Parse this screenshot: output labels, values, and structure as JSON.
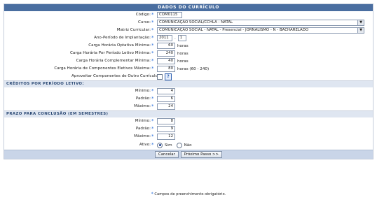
{
  "title": "Dados do Currículo",
  "fields": {
    "codigo": {
      "label": "Código:",
      "value": "COM0115"
    },
    "curso": {
      "label": "Curso:",
      "value": "COMUNICAÇÃO SOCIAL/CCHLA - NATAL"
    },
    "matriz": {
      "label": "Matriz Curricular:",
      "value": "COMUNICAÇÃO SOCIAL - NATAL - Presencial - JORNALISMO - N - BACHARELADO"
    },
    "ano_periodo": {
      "label": "Ano-Período de Implantação:",
      "ano": "2011",
      "sep": ".",
      "periodo": "1"
    },
    "ch_optativa": {
      "label": "Carga Horária Optativa Mínima:",
      "value": "60",
      "unit": "horas"
    },
    "ch_periodo": {
      "label": "Carga Horária Por Período Letivo Mínima:",
      "value": "240",
      "unit": "horas"
    },
    "ch_complementar": {
      "label": "Carga Horária Complementar Mínima:",
      "value": "40",
      "unit": "horas"
    },
    "ch_eletivos": {
      "label": "Carga Horária de Componentes Eletivos Máxima:",
      "value": "80",
      "unit": "horas (60 - 240)"
    },
    "aproveitar": {
      "label": "Aproveitar Componentes de Outro Currículo",
      "help": "?"
    }
  },
  "creditos": {
    "title": "Créditos Por Período Letivo:",
    "minimo": {
      "label": "Mínimo:",
      "value": "4"
    },
    "padrao": {
      "label": "Padrão:",
      "value": "6"
    },
    "maximo": {
      "label": "Máximo:",
      "value": "24"
    }
  },
  "prazo": {
    "title": "Prazo Para Conclusão (em semestres)",
    "minimo": {
      "label": "Mínimo:",
      "value": "8"
    },
    "padrao": {
      "label": "Padrão:",
      "value": "9"
    },
    "maximo": {
      "label": "Máximo:",
      "value": "12"
    }
  },
  "ativo": {
    "label": "Ativo:",
    "sim": "Sim",
    "nao": "Não",
    "selected": "Sim"
  },
  "buttons": {
    "cancelar": "Cancelar",
    "proximo": "Próximo Passo >>"
  },
  "footer": {
    "required_note": "Campos de preenchimento obrigatório.",
    "star": "*"
  },
  "colors": {
    "header": "#4a6ea0",
    "section": "#dfe6f1",
    "required_star": "#2a6fdb"
  }
}
